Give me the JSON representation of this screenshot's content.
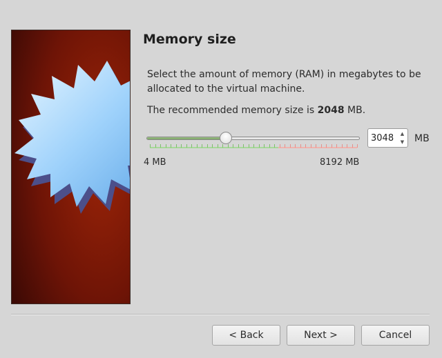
{
  "window": {
    "title": "Memory size"
  },
  "content": {
    "description": "Select the amount of memory (RAM) in megabytes to be allocated to the virtual machine.",
    "recommended_prefix": "The recommended memory size is ",
    "recommended_value": "2048",
    "recommended_suffix": " MB."
  },
  "memory": {
    "min_label": "4 MB",
    "max_label": "8192 MB",
    "value": "3048",
    "unit": "MB",
    "slider_value": 3048,
    "slider_min": 4,
    "slider_max": 8192,
    "recommended_max_fraction": 0.62
  },
  "icons": {
    "spin_up": "▲",
    "spin_down": "▼"
  },
  "buttons": {
    "back": "< Back",
    "next": "Next >",
    "cancel": "Cancel"
  },
  "colors": {
    "image_bg": "#8a1a08",
    "starburst": "#bfe6ff",
    "slider_fill": "#7aa363",
    "tick_ok": "#7cc16a",
    "tick_warn": "#e88f8a"
  }
}
